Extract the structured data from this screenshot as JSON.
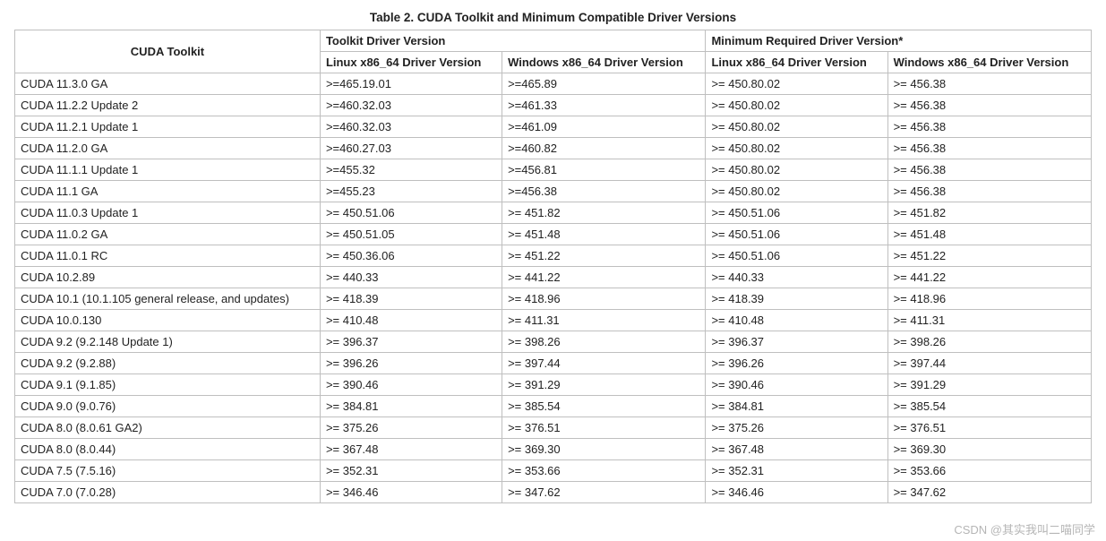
{
  "caption": "Table 2. CUDA Toolkit and Minimum Compatible Driver Versions",
  "header": {
    "col1": "CUDA Toolkit",
    "group1": "Toolkit Driver Version",
    "group2": "Minimum Required Driver Version*",
    "sub1": "Linux x86_64 Driver Version",
    "sub2": "Windows x86_64 Driver Version",
    "sub3": "Linux x86_64 Driver Version",
    "sub4": "Windows x86_64 Driver Version"
  },
  "rows": [
    {
      "toolkit": "CUDA 11.3.0 GA",
      "t_linux": ">=465.19.01",
      "t_win": ">=465.89",
      "m_linux": ">= 450.80.02",
      "m_win": ">= 456.38"
    },
    {
      "toolkit": "CUDA 11.2.2 Update 2",
      "t_linux": ">=460.32.03",
      "t_win": ">=461.33",
      "m_linux": ">= 450.80.02",
      "m_win": ">= 456.38"
    },
    {
      "toolkit": "CUDA 11.2.1 Update 1",
      "t_linux": ">=460.32.03",
      "t_win": ">=461.09",
      "m_linux": ">= 450.80.02",
      "m_win": ">= 456.38"
    },
    {
      "toolkit": "CUDA 11.2.0 GA",
      "t_linux": ">=460.27.03",
      "t_win": ">=460.82",
      "m_linux": ">= 450.80.02",
      "m_win": ">= 456.38"
    },
    {
      "toolkit": "CUDA 11.1.1 Update 1",
      "t_linux": ">=455.32",
      "t_win": ">=456.81",
      "m_linux": ">= 450.80.02",
      "m_win": ">= 456.38"
    },
    {
      "toolkit": "CUDA 11.1 GA",
      "t_linux": ">=455.23",
      "t_win": ">=456.38",
      "m_linux": ">= 450.80.02",
      "m_win": ">= 456.38"
    },
    {
      "toolkit": "CUDA 11.0.3 Update 1",
      "t_linux": ">= 450.51.06",
      "t_win": ">= 451.82",
      "m_linux": ">= 450.51.06",
      "m_win": ">= 451.82"
    },
    {
      "toolkit": "CUDA 11.0.2 GA",
      "t_linux": ">= 450.51.05",
      "t_win": ">= 451.48",
      "m_linux": ">= 450.51.06",
      "m_win": ">= 451.48"
    },
    {
      "toolkit": "CUDA 11.0.1 RC",
      "t_linux": ">= 450.36.06",
      "t_win": ">= 451.22",
      "m_linux": ">= 450.51.06",
      "m_win": ">= 451.22"
    },
    {
      "toolkit": "CUDA 10.2.89",
      "t_linux": ">= 440.33",
      "t_win": ">= 441.22",
      "m_linux": ">= 440.33",
      "m_win": ">= 441.22"
    },
    {
      "toolkit": "CUDA 10.1 (10.1.105 general release, and updates)",
      "t_linux": ">= 418.39",
      "t_win": ">= 418.96",
      "m_linux": ">= 418.39",
      "m_win": ">= 418.96"
    },
    {
      "toolkit": "CUDA 10.0.130",
      "t_linux": ">= 410.48",
      "t_win": ">= 411.31",
      "m_linux": ">= 410.48",
      "m_win": ">= 411.31"
    },
    {
      "toolkit": "CUDA 9.2 (9.2.148 Update 1)",
      "t_linux": ">= 396.37",
      "t_win": ">= 398.26",
      "m_linux": ">= 396.37",
      "m_win": ">= 398.26"
    },
    {
      "toolkit": "CUDA 9.2 (9.2.88)",
      "t_linux": ">= 396.26",
      "t_win": ">= 397.44",
      "m_linux": ">= 396.26",
      "m_win": ">= 397.44"
    },
    {
      "toolkit": "CUDA 9.1 (9.1.85)",
      "t_linux": ">= 390.46",
      "t_win": ">= 391.29",
      "m_linux": ">= 390.46",
      "m_win": ">= 391.29"
    },
    {
      "toolkit": "CUDA 9.0 (9.0.76)",
      "t_linux": ">= 384.81",
      "t_win": ">= 385.54",
      "m_linux": ">= 384.81",
      "m_win": ">= 385.54"
    },
    {
      "toolkit": "CUDA 8.0 (8.0.61 GA2)",
      "t_linux": ">= 375.26",
      "t_win": ">= 376.51",
      "m_linux": ">= 375.26",
      "m_win": ">= 376.51"
    },
    {
      "toolkit": "CUDA 8.0 (8.0.44)",
      "t_linux": ">= 367.48",
      "t_win": ">= 369.30",
      "m_linux": ">= 367.48",
      "m_win": ">= 369.30"
    },
    {
      "toolkit": "CUDA 7.5 (7.5.16)",
      "t_linux": ">= 352.31",
      "t_win": ">= 353.66",
      "m_linux": ">= 352.31",
      "m_win": ">= 353.66"
    },
    {
      "toolkit": "CUDA 7.0 (7.0.28)",
      "t_linux": ">= 346.46",
      "t_win": ">= 347.62",
      "m_linux": ">= 346.46",
      "m_win": ">= 347.62"
    }
  ],
  "watermark": "CSDN @其实我叫二喵同学\u0002"
}
